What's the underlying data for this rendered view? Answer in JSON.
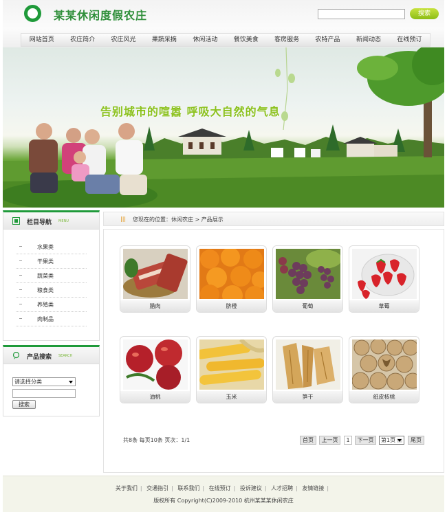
{
  "site": {
    "title": "某某休闲度假农庄",
    "search_button": "搜索"
  },
  "nav": [
    "网站首页",
    "农庄简介",
    "农庄风光",
    "果蔬采摘",
    "休闲活动",
    "餐饮美食",
    "客房服务",
    "农特产品",
    "新闻动态",
    "在线预订"
  ],
  "banner": {
    "slogan": "告别城市的喧嚣  呼吸大自然的气息"
  },
  "sidebar": {
    "menu_title": "栏目导航",
    "menu_en": "MENU",
    "menu_items": [
      "水果类",
      "干果类",
      "蔬菜类",
      "粮食类",
      "养殖类",
      "肉制品"
    ],
    "search_title": "产品搜索",
    "search_en": "SEARCH",
    "category_placeholder": "请选择分类",
    "search_button": "搜索"
  },
  "breadcrumb": {
    "text": "您现在的位置：休闲农庄 > 产品展示"
  },
  "products": [
    "腊肉",
    "脐橙",
    "葡萄",
    "草莓",
    "油桃",
    "玉米",
    "笋干",
    "纸皮核桃"
  ],
  "pager": {
    "info": "共8条  每页10条  页次：1/1",
    "first": "首页",
    "prev": "上一页",
    "current": "1",
    "next": "下一页",
    "page_select": "第1页",
    "last": "尾页"
  },
  "footer": {
    "links": [
      "关于我们",
      "交通指引",
      "联系我们",
      "在线预订",
      "投诉建议",
      "人才招聘",
      "友情链接"
    ],
    "copyright": "版权所有  Copyright(C)2009-2010 杭州某某某休闲农庄"
  },
  "colors": {
    "brand_green": "#1f9a3a",
    "accent_lime": "#8bc11c",
    "footer_bg": "#f3f4ea"
  }
}
